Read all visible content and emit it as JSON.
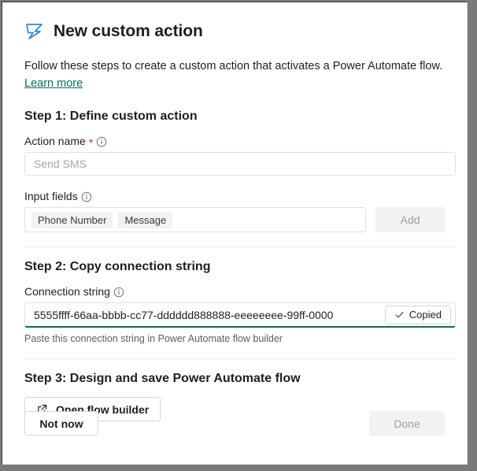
{
  "dialog": {
    "title": "New custom action",
    "icon": "power-automate-flow-icon",
    "intro_text": "Follow these steps to create a custom action that activates a Power Automate flow.",
    "learn_more_label": "Learn more",
    "accent_color": "#0f6b5c",
    "icon_color": "#2d8ad4",
    "required_color": "#c4314b"
  },
  "step1": {
    "heading": "Step 1: Define custom action",
    "action_name_label": "Action name",
    "required_marker": "*",
    "action_name_value": "",
    "action_name_placeholder": "Send SMS",
    "input_fields_label": "Input fields",
    "chips": [
      "Phone Number",
      "Message"
    ],
    "add_label": "Add"
  },
  "step2": {
    "heading": "Step 2: Copy connection string",
    "connection_string_label": "Connection string",
    "connection_string_value": "5555ffff-66aa-bbbb-cc77-dddddd888888-eeeeeeee-99ff-0000",
    "copied_label": "Copied",
    "hint": "Paste this connection string in Power Automate flow builder"
  },
  "step3": {
    "heading": "Step 3: Design and save Power Automate flow",
    "open_flow_builder_label": "Open flow builder"
  },
  "footer": {
    "not_now_label": "Not now",
    "done_label": "Done"
  }
}
